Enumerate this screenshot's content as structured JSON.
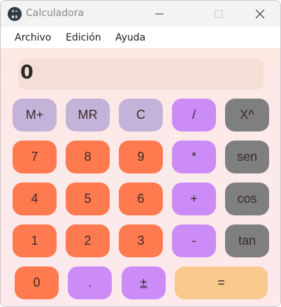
{
  "window": {
    "title": "Calculadora",
    "icon": "calculator-app-icon"
  },
  "menu": {
    "items": [
      "Archivo",
      "Edición",
      "Ayuda"
    ]
  },
  "display": {
    "value": "0"
  },
  "buttons": {
    "row1": [
      "M+",
      "MR",
      "C",
      "/",
      "X^"
    ],
    "row2": [
      "7",
      "8",
      "9",
      "*",
      "sen"
    ],
    "row3": [
      "4",
      "5",
      "6",
      "+",
      "cos"
    ],
    "row4": [
      "1",
      "2",
      "3",
      "-",
      "tan"
    ],
    "row5": [
      "0",
      ".",
      "±",
      "="
    ]
  },
  "colors": {
    "memory": "#c4b3d9",
    "number": "#ff7a4f",
    "operator": "#cc8cf7",
    "function": "#7f7f7f",
    "equals": "#f8c98c",
    "display_bg": "#f5ded6"
  }
}
